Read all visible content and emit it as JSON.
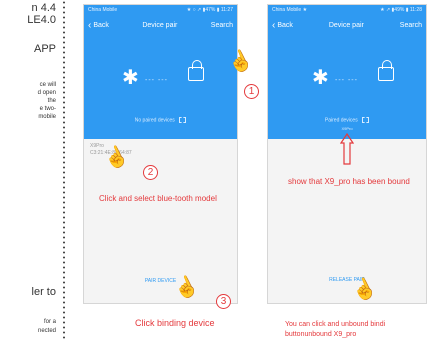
{
  "left_column": {
    "line1": "n 4.4",
    "line2": "LE4.0",
    "heading": "APP",
    "para": [
      "ce will",
      "d open",
      "the",
      "e two-",
      "mobile"
    ],
    "heading2": "ler to",
    "para2": [
      "for a",
      "nected"
    ]
  },
  "phone1": {
    "status_carrier": "China Mobile",
    "status_right": "★ ○ ↗ ▮47% ▮ 11:27",
    "back_label": "Back",
    "title": "Device pair",
    "search_label": "Search",
    "no_paired": "No paired devices",
    "device_name": "X9Pro",
    "device_mac": "C3:21:4E:88:64:87",
    "pair_button": "PAIR DEVICE"
  },
  "phone2": {
    "status_carrier": "China Mobile ★",
    "status_right": "★ ↗ ▮49% ▮ 11:28",
    "back_label": "Back",
    "title": "Device pair",
    "search_label": "Search",
    "paired_devices": "Paired devices",
    "paired_name": "X9Pro",
    "release_button": "RELEASE PAIR"
  },
  "annotations": {
    "step1": "1",
    "step2": "2",
    "step3": "3",
    "caption_select": "Click and select blue-tooth model",
    "caption_bind": "Click binding device",
    "caption_bound": "show that X9_pro has been bound",
    "caption_unbind_1": "You can click and unbound bindi",
    "caption_unbind_2": "buttonunbound X9_pro"
  },
  "colors": {
    "app_blue": "#2f9af2",
    "annotation_red": "#e4393c"
  },
  "icons": [
    "bluetooth-icon",
    "unlock-icon",
    "scan-icon",
    "chevron-left-icon",
    "pointing-hand-icon",
    "up-arrow-icon"
  ]
}
